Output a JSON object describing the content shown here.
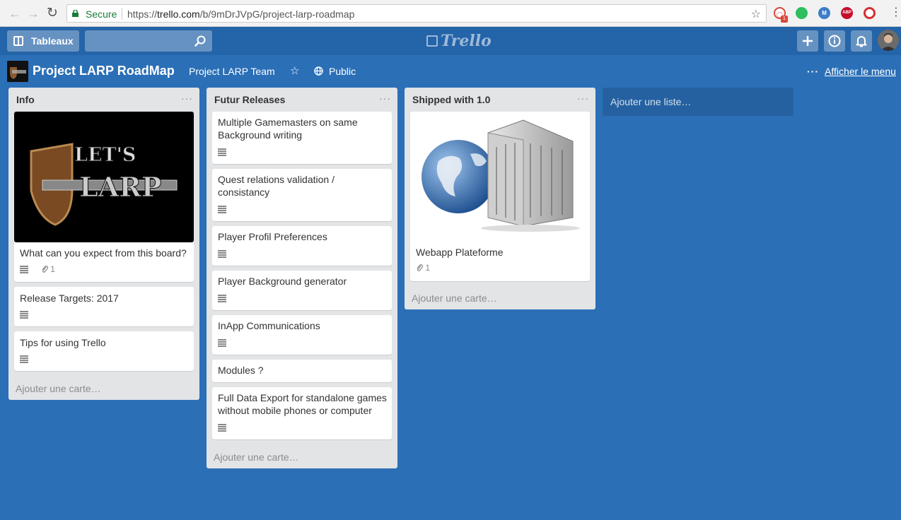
{
  "browser": {
    "secure_label": "Secure",
    "url_scheme": "https://",
    "url_host": "trello.com",
    "url_path": "/b/9mDrJVpG/project-larp-roadmap",
    "extensions": [
      {
        "name": "onetab",
        "badge": "1",
        "color": "#d9493a"
      },
      {
        "name": "evernote",
        "color": "#2dbe60"
      },
      {
        "name": "mercury",
        "color": "#3d7cc9",
        "letter": "M"
      },
      {
        "name": "adblock-plus",
        "color": "#c70d2c",
        "letter": "ABP"
      },
      {
        "name": "opera-vpn",
        "color": "#d32f2f"
      }
    ]
  },
  "header": {
    "boards_label": "Tableaux",
    "logo_text": "Trello"
  },
  "board": {
    "title": "Project LARP RoadMap",
    "team": "Project LARP Team",
    "visibility": "Public",
    "menu_label": "Afficher le menu",
    "add_list_label": "Ajouter une liste…"
  },
  "lists": [
    {
      "title": "Info",
      "add_card_label": "Ajouter une carte…",
      "cards": [
        {
          "title": "What can you expect from this board?",
          "cover": "Let's LARP logo",
          "cover_text_top": "LET'S",
          "cover_text_bottom": "LARP",
          "attachments": "1"
        },
        {
          "title": "Release Targets: 2017"
        },
        {
          "title": "Tips for using Trello"
        }
      ]
    },
    {
      "title": "Futur Releases",
      "add_card_label": "Ajouter une carte…",
      "cards": [
        {
          "title": "Multiple Gamemasters on same Background writing"
        },
        {
          "title": "Quest relations validation / consistancy"
        },
        {
          "title": "Player Profil Preferences"
        },
        {
          "title": "Player Background generator"
        },
        {
          "title": "InApp Communications"
        },
        {
          "title": "Modules ?"
        },
        {
          "title": "Full Data Export for standalone games without mobile phones or computer"
        }
      ]
    },
    {
      "title": "Shipped with 1.0",
      "add_card_label": "Ajouter une carte…",
      "cards": [
        {
          "title": "Webapp Plateforme",
          "cover": "Globe and servers",
          "attachments": "1"
        }
      ]
    }
  ],
  "colors": {
    "board_bg": "#2b6fb7",
    "header_bg": "#2464a8",
    "list_bg": "#e2e4e6",
    "card_bg": "#ffffff"
  }
}
